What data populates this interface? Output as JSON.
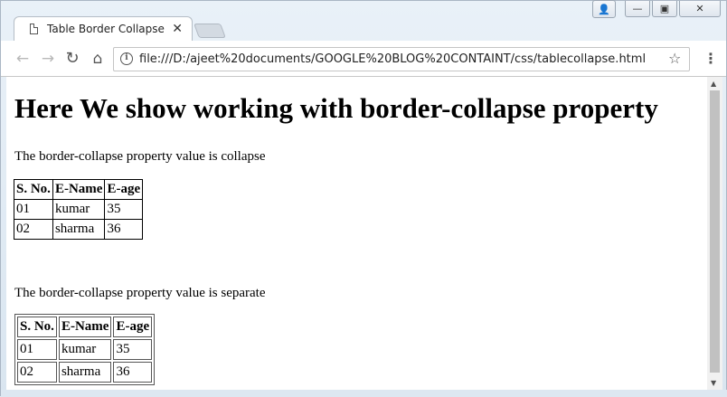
{
  "tab": {
    "title": "Table Border Collapse",
    "close_glyph": "✕"
  },
  "toolbar": {
    "back_glyph": "←",
    "forward_glyph": "→",
    "reload_glyph": "↻",
    "home_glyph": "⌂",
    "url": "file:///D:/ajeet%20documents/GOOGLE%20BLOG%20CONTAINT/css/tablecollapse.html",
    "info_glyph": "i",
    "star_glyph": "☆",
    "menu_glyph": "⋮"
  },
  "window_controls": {
    "minimize_glyph": "—",
    "maximize_glyph": "▣",
    "close_glyph": "✕",
    "user_glyph": "👤"
  },
  "page": {
    "heading": "Here We show working with border-collapse property",
    "collapse_text": "The border-collapse property value is collapse",
    "separate_text": "The border-collapse property value is separate",
    "table": {
      "headers": [
        "S. No.",
        "E-Name",
        "E-age"
      ],
      "rows": [
        [
          "01",
          "kumar",
          "35"
        ],
        [
          "02",
          "sharma",
          "36"
        ]
      ]
    }
  },
  "scrollbar": {
    "up_glyph": "▲",
    "down_glyph": "▼"
  }
}
